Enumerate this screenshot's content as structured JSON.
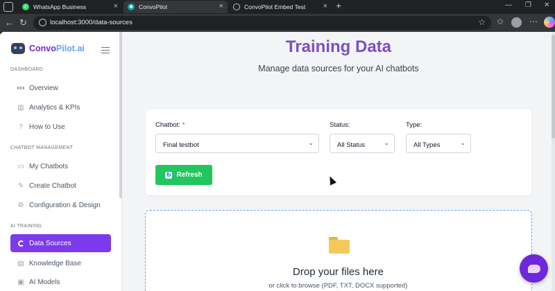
{
  "browser": {
    "tabs": [
      {
        "label": "WhatsApp Business",
        "active": false
      },
      {
        "label": "ConvoPilot",
        "active": true
      },
      {
        "label": "ConvoPilot Embed Test",
        "active": false
      }
    ],
    "url": "localhost:3000/data-sources"
  },
  "brand": {
    "part1": "Convo",
    "part2": "Pilot.ai"
  },
  "sidebar": {
    "sections": [
      {
        "title": "DASHBOARD",
        "items": [
          "Overview",
          "Analytics & KPIs",
          "How to Use"
        ]
      },
      {
        "title": "CHATBOT MANAGEMENT",
        "items": [
          "My Chatbots",
          "Create Chatbot",
          "Configuration & Design"
        ]
      },
      {
        "title": "AI TRAINING",
        "items": [
          "Data Sources",
          "Knowledge Base",
          "AI Models"
        ]
      }
    ],
    "active_item": "Data Sources"
  },
  "page": {
    "title": "Training Data",
    "subtitle": "Manage data sources for your AI chatbots"
  },
  "filters": {
    "chatbot_label": "Chatbot:",
    "required_mark": "*",
    "chatbot_value": "Final testbot",
    "status_label": "Status:",
    "status_value": "All Status",
    "type_label": "Type:",
    "type_value": "All Types",
    "refresh_label": "Refresh"
  },
  "upload": {
    "title": "Drop your files here",
    "subtitle": "or click to browse (PDF, TXT, DOCX supported)"
  },
  "colors": {
    "accent": "#7c3aed",
    "success": "#22c55e",
    "drop_border": "#60a5fa"
  }
}
